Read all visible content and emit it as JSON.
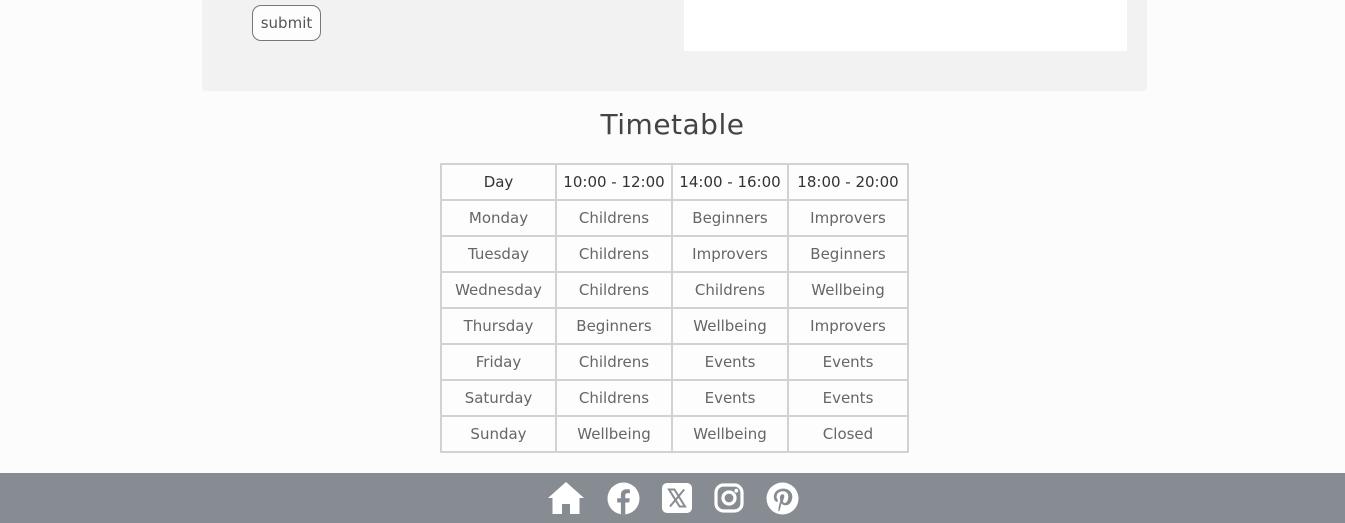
{
  "form": {
    "submit_label": "submit"
  },
  "timetable": {
    "title": "Timetable",
    "headers": [
      "Day",
      "10:00 - 12:00",
      "14:00 - 16:00",
      "18:00 - 20:00"
    ],
    "rows": [
      [
        "Monday",
        "Childrens",
        "Beginners",
        "Improvers"
      ],
      [
        "Tuesday",
        "Childrens",
        "Improvers",
        "Beginners"
      ],
      [
        "Wednesday",
        "Childrens",
        "Childrens",
        "Wellbeing"
      ],
      [
        "Thursday",
        "Beginners",
        "Wellbeing",
        "Improvers"
      ],
      [
        "Friday",
        "Childrens",
        "Events",
        "Events"
      ],
      [
        "Saturday",
        "Childrens",
        "Events",
        "Events"
      ],
      [
        "Sunday",
        "Wellbeing",
        "Wellbeing",
        "Closed"
      ]
    ]
  },
  "footer": {
    "icons": [
      "home-icon",
      "facebook-icon",
      "x-twitter-icon",
      "instagram-icon",
      "pinterest-icon"
    ]
  },
  "colors": {
    "background": "#fcfcfc",
    "panel": "#f2f2f2",
    "footer": "#878c93",
    "table_border": "#d2d2d2",
    "footer_icon": "#ffffff"
  }
}
